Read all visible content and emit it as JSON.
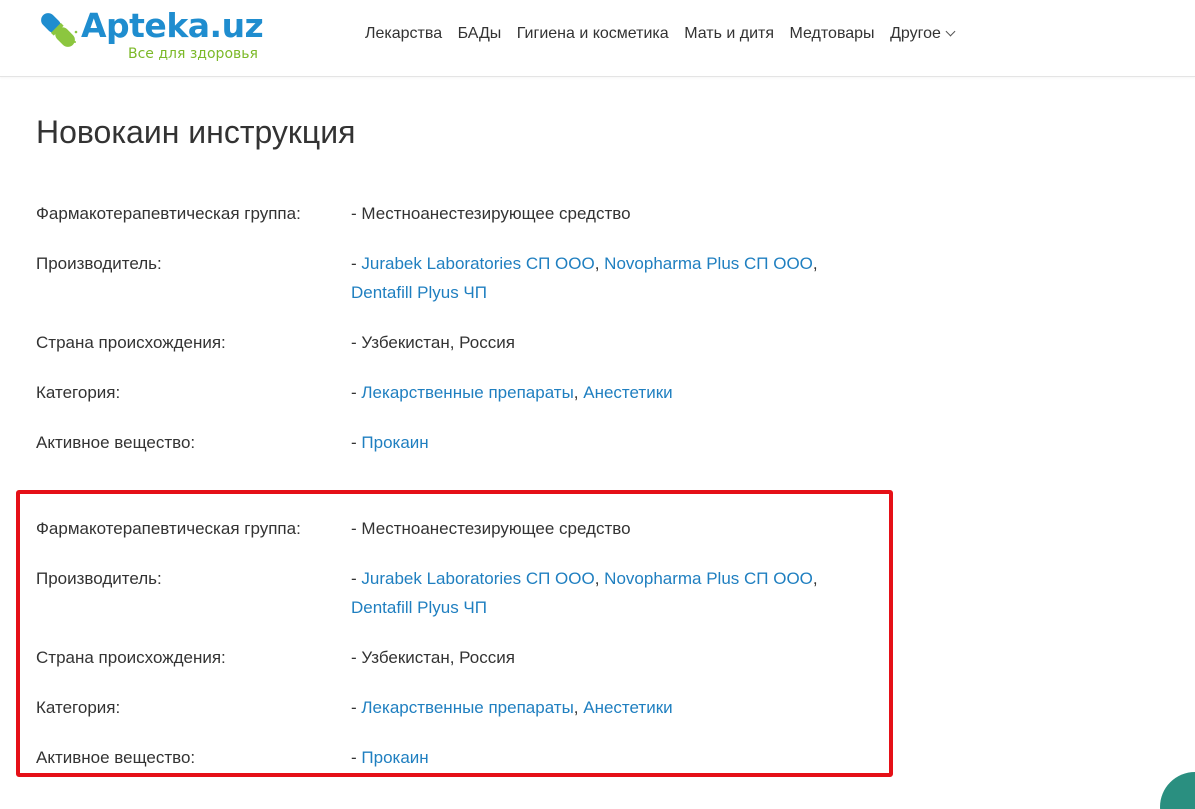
{
  "site": {
    "logo_text": "Apteka.uz",
    "logo_tagline": "Все для здоровья",
    "brand_color": "#1f8dcf",
    "tagline_color": "#7cb928",
    "link_color": "#1f7fc0",
    "highlight_color": "#e51017"
  },
  "nav": {
    "items": [
      "Лекарства",
      "БАДы",
      "Гигиена и косметика",
      "Мать и дитя",
      "Медтовары"
    ],
    "more_label": "Другое"
  },
  "page": {
    "title": "Новокаин инструкция"
  },
  "info": {
    "pharm_group_label": "Фармакотерапевтическая группа:",
    "pharm_group_value": "- Местноанестезирующее средство",
    "manufacturer_label": "Производитель:",
    "manufacturer_prefix": "- ",
    "manufacturers": [
      "Jurabek Laboratories СП ООО",
      "Novopharma Plus СП ООО",
      "Dentafill Plyus ЧП"
    ],
    "country_label": "Страна происхождения:",
    "country_value": "- Узбекистан, Россия",
    "category_label": "Категория:",
    "category_prefix": "- ",
    "categories": [
      "Лекарственные препараты",
      "Анестетики"
    ],
    "substance_label": "Активное вещество:",
    "substance_prefix": "- ",
    "substance": "Прокаин",
    "separator": ", "
  }
}
